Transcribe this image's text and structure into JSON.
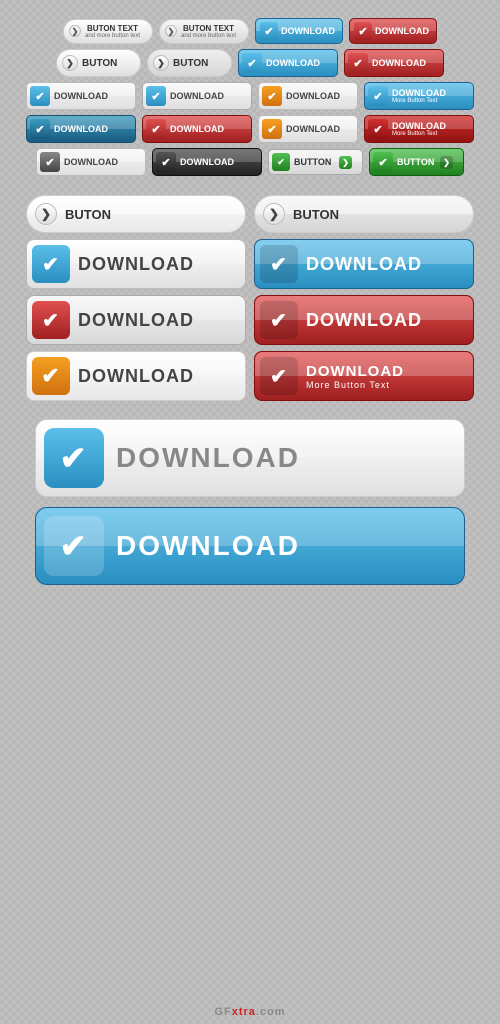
{
  "buttons": {
    "row1": {
      "btn1": {
        "main": "BUTON TEXT",
        "sub": "and more button text",
        "chevron": "❯"
      },
      "btn2": {
        "main": "BUTON TEXT",
        "sub": "and more button text",
        "chevron": "❯"
      },
      "btn3": {
        "label": "DOWNLOAD"
      },
      "btn4": {
        "label": "DOWNLOAD"
      }
    },
    "row2": {
      "btn1": {
        "label": "BUTON",
        "chevron": "❯"
      },
      "btn2": {
        "label": "BUTON",
        "chevron": "❯"
      },
      "btn3": {
        "label": "DOWNLOAD"
      },
      "btn4": {
        "label": "DOWNLOAD"
      }
    },
    "row3": {
      "btn1": {
        "label": "DOWNLOAD"
      },
      "btn2": {
        "label": "DOWNLOAD"
      },
      "btn3": {
        "label": "DOWNLOAD"
      },
      "btn4": {
        "main": "DOWNLOAD",
        "sub": "More Button Text"
      }
    },
    "row4": {
      "btn1": {
        "label": "DOWNLOAD"
      },
      "btn2": {
        "label": "DOWNLOAD"
      },
      "btn3": {
        "label": "DOWNLOAD"
      },
      "btn4": {
        "main": "DOWNLOAD",
        "sub": "More Button Text"
      }
    },
    "row5": {
      "btn1": {
        "label": "DOWNLOAD"
      },
      "btn2": {
        "label": "DOWNLOAD"
      },
      "btn3": {
        "label": "BUTTON"
      },
      "btn4": {
        "label": "BUTTON"
      }
    },
    "large_row1": {
      "btn1": {
        "label": "BUTON",
        "chevron": "❯"
      },
      "btn2": {
        "label": "BUTON",
        "chevron": "❯"
      }
    },
    "large_row2": {
      "btn1": {
        "label": "DOWNLOAD"
      },
      "btn2": {
        "label": "DOWNLOAD"
      }
    },
    "large_row3": {
      "btn1": {
        "label": "DOWNLOAD"
      },
      "btn2": {
        "label": "DOWNLOAD"
      }
    },
    "large_row4": {
      "btn1": {
        "label": "DOWNLOAD"
      },
      "btn2": {
        "main": "DOWNLOAD",
        "sub": "More Button Text"
      }
    },
    "xl_row1": {
      "label": "DOWNLOAD"
    },
    "xl_row2": {
      "label": "DOWNLOAD"
    }
  },
  "watermark": {
    "site": "GFxtra",
    "tld": ".com"
  }
}
